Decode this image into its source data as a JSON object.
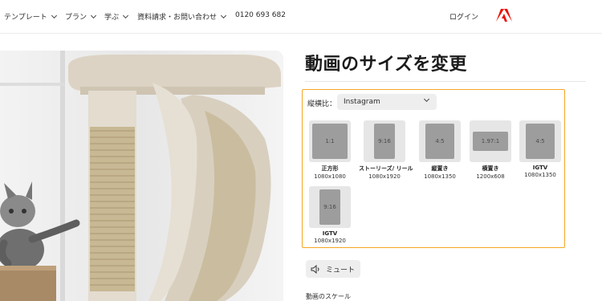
{
  "nav": {
    "items": [
      {
        "label": "テンプレート"
      },
      {
        "label": "プラン"
      },
      {
        "label": "学ぶ"
      },
      {
        "label": "資料請求・お問い合わせ"
      }
    ],
    "phone": "0120 693 682",
    "login": "ログイン",
    "logo_icon": "adobe-logo",
    "brand_color": "#eb1000"
  },
  "photo": {
    "icon": "cat-tree-kitten-photo"
  },
  "editor": {
    "title": "動画のサイズを変更",
    "aspect_label": "縦横比：",
    "aspect_select": "Instagram",
    "highlight_color": "#f5a623",
    "presets": [
      {
        "ratio": "1:1",
        "name": "正方形",
        "size": "1080x1080"
      },
      {
        "ratio": "9:16",
        "name": "ストーリーズ/ リール",
        "size": "1080x1920"
      },
      {
        "ratio": "4:5",
        "name": "縦置き",
        "size": "1080x1350"
      },
      {
        "ratio": "1.97:1",
        "name": "横置き",
        "size": "1200x608"
      },
      {
        "ratio": "4:5",
        "name": "IGTV",
        "size": "1080x1350"
      },
      {
        "ratio": "9:16",
        "name": "IGTV",
        "size": "1080x1920"
      }
    ],
    "mute_label": "ミュート",
    "mute_icon": "speaker-mute-icon",
    "scale_label": "動画のスケール"
  }
}
